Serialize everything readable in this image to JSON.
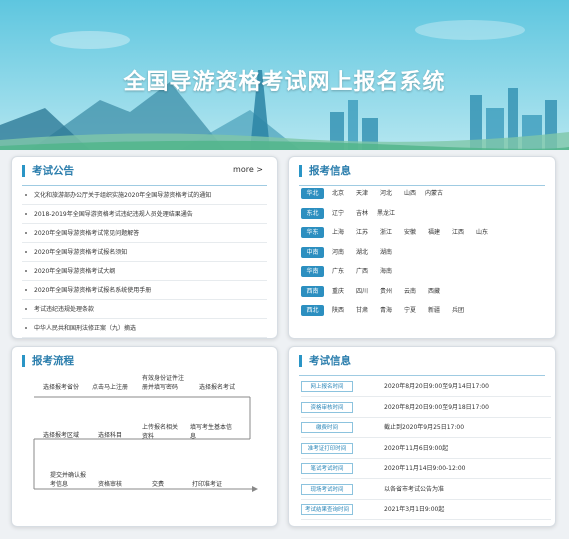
{
  "banner": {
    "title": "全国导游资格考试网上报名系统"
  },
  "announcements": {
    "title": "考试公告",
    "more": "more >",
    "items": [
      "文化和旅游部办公厅关于组织实施2020年全国导游资格考试的通知",
      "2018-2019年全国导游资格考试违纪违规人员处理结果通告",
      "2020年全国导游资格考试常见问题解答",
      "2020年全国导游资格考试报名须知",
      "2020年全国导游资格考试大纲",
      "2020年全国导游资格考试报名系统使用手册",
      "考试违纪违规处理条款",
      "中华人民共和国刑法修正案（九）摘选"
    ]
  },
  "regions": {
    "title": "报考信息",
    "rows": [
      {
        "region": "华北",
        "provinces": [
          "北京",
          "天津",
          "河北",
          "山西",
          "内蒙古"
        ]
      },
      {
        "region": "东北",
        "provinces": [
          "辽宁",
          "吉林",
          "黑龙江"
        ]
      },
      {
        "region": "华东",
        "provinces": [
          "上海",
          "江苏",
          "浙江",
          "安徽",
          "福建",
          "江西",
          "山东"
        ]
      },
      {
        "region": "中南",
        "provinces": [
          "河南",
          "湖北",
          "湖南"
        ]
      },
      {
        "region": "华南",
        "provinces": [
          "广东",
          "广西",
          "海南"
        ]
      },
      {
        "region": "西南",
        "provinces": [
          "重庆",
          "四川",
          "贵州",
          "云南",
          "西藏"
        ]
      },
      {
        "region": "西北",
        "provinces": [
          "陕西",
          "甘肃",
          "青海",
          "宁夏",
          "新疆",
          "兵团"
        ]
      }
    ]
  },
  "flow": {
    "title": "报考流程",
    "steps": {
      "s1": "选择报考省份",
      "s2": "点击马上注册",
      "s3": "有效身份证件注\n册并填写密码",
      "s4": "选择报名考试",
      "s5": "选择报考区域",
      "s6": "选择科目",
      "s7": "上传报名相关\n资料",
      "s8": "填写考生基本信\n息",
      "s9": "提交并确认报\n考信息",
      "s10": "资格审核",
      "s11": "交费",
      "s12": "打印准考证"
    }
  },
  "exam_info": {
    "title": "考试信息",
    "rows": [
      {
        "label": "网上报名时间",
        "value": "2020年8月20日9:00至9月14日17:00"
      },
      {
        "label": "资格审核时间",
        "value": "2020年8月20日9:00至9月18日17:00"
      },
      {
        "label": "缴费时间",
        "value": "截止到2020年9月25日17:00"
      },
      {
        "label": "准考证打印时间",
        "value": "2020年11月6日9:00起"
      },
      {
        "label": "笔试考试时间",
        "value": "2020年11月14日9:00-12:00"
      },
      {
        "label": "现场考试时间",
        "value": "以各省市考试公告为准"
      },
      {
        "label": "考试结果查询时间",
        "value": "2021年3月1日9:00起"
      }
    ]
  },
  "colors": {
    "accent": "#2a95c6",
    "banner_top": "#62c9e0",
    "banner_bottom": "#a9e2ee"
  }
}
